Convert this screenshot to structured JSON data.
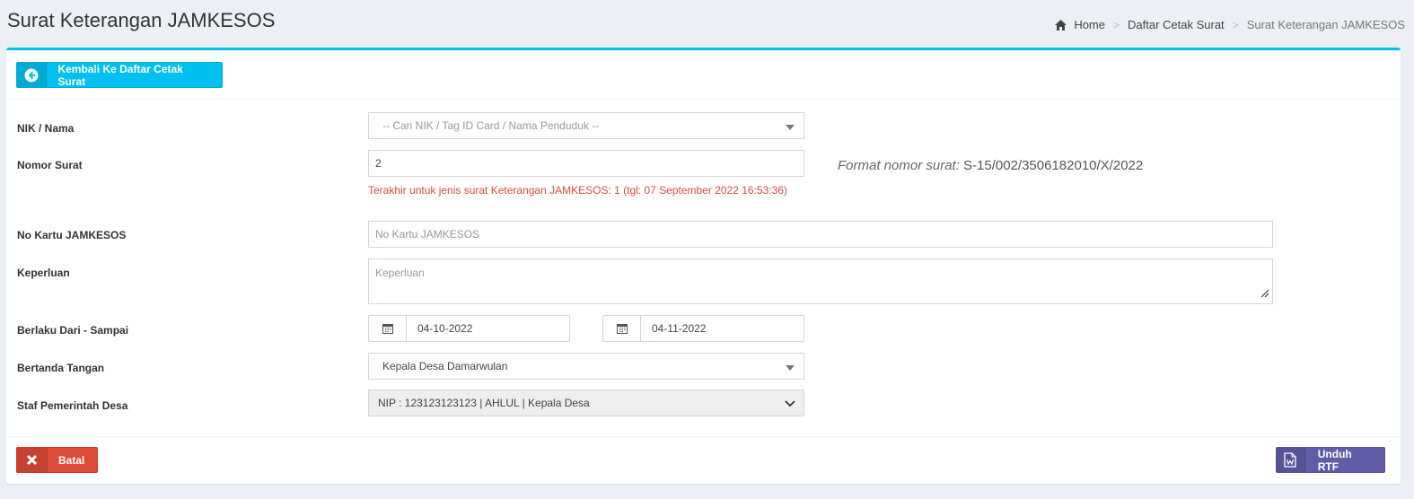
{
  "header": {
    "title": "Surat Keterangan JAMKESOS",
    "breadcrumb": {
      "home": "Home",
      "sep": ">",
      "item2": "Daftar Cetak Surat",
      "item3": "Surat Keterangan JAMKESOS"
    }
  },
  "toolbar": {
    "back_label": "Kembali Ke Daftar Cetak Surat"
  },
  "form": {
    "nik": {
      "label": "NIK / Nama",
      "placeholder": "-- Cari NIK / Tag ID Card / Nama Penduduk --"
    },
    "nomor": {
      "label": "Nomor Surat",
      "value": "2",
      "hint": "Terakhir untuk jenis surat Keterangan JAMKESOS: 1 (tgl: 07 September 2022 16:53:36)",
      "format_label": "Format nomor surat:",
      "format_value": " S-15/002/3506182010/X/2022"
    },
    "kartu": {
      "label": "No Kartu JAMKESOS",
      "placeholder": "No Kartu JAMKESOS"
    },
    "keperluan": {
      "label": "Keperluan",
      "placeholder": "Keperluan"
    },
    "berlaku": {
      "label": "Berlaku Dari - Sampai",
      "from": "04-10-2022",
      "to": "04-11-2022"
    },
    "ttd": {
      "label": "Bertanda Tangan",
      "value": "Kepala Desa Damarwulan"
    },
    "staf": {
      "label": "Staf Pemerintah Desa",
      "value": "NIP : 123123123123 | AHLUL | Kepala Desa"
    }
  },
  "footer": {
    "cancel_label": "Batal",
    "rtf_label": "Unduh RTF"
  },
  "colors": {
    "info": "#00c0ef",
    "danger": "#dd4b39",
    "purple": "#605ca8"
  }
}
